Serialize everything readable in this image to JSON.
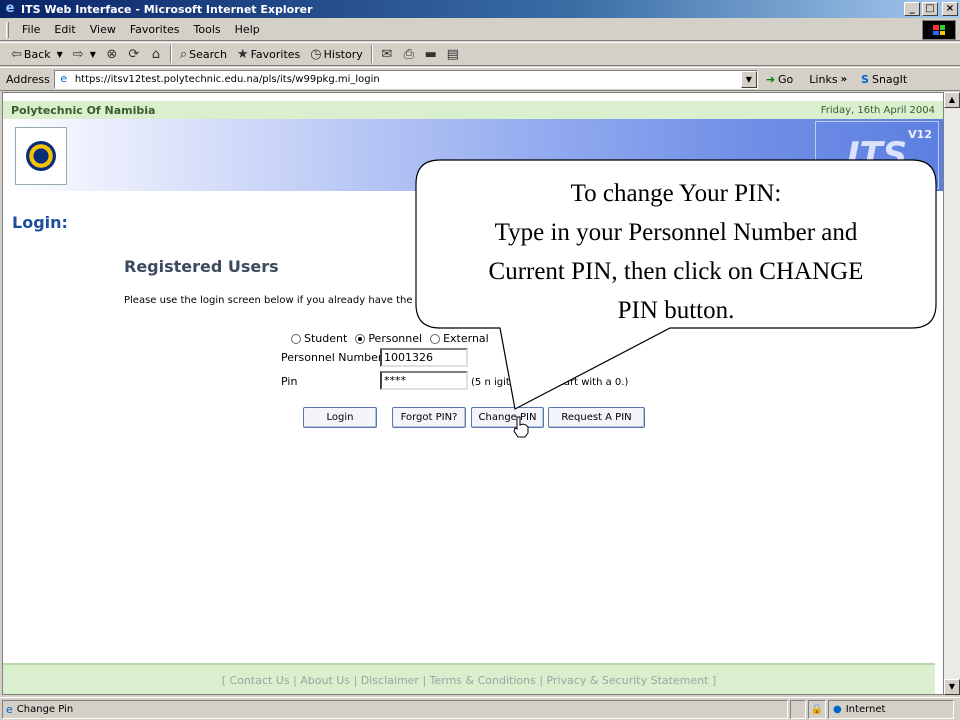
{
  "window": {
    "title": "ITS Web Interface - Microsoft Internet Explorer"
  },
  "menu": [
    "File",
    "Edit",
    "View",
    "Favorites",
    "Tools",
    "Help"
  ],
  "toolbar": {
    "back": "Back",
    "search": "Search",
    "favorites": "Favorites",
    "history": "History"
  },
  "address": {
    "label": "Address",
    "url": "https://itsv12test.polytechnic.edu.na/pls/its/w99pkg.mi_login",
    "go": "Go",
    "links": "Links",
    "snagit": "SnagIt"
  },
  "page": {
    "site_name": "Polytechnic Of Namibia",
    "date": "Friday, 16th April 2004",
    "login_heading": "Login:",
    "registered_heading": "Registered Users",
    "registered_text": "Please use the login screen below if you already have the",
    "radio_options": [
      {
        "label": "Student",
        "selected": false
      },
      {
        "label": "Personnel",
        "selected": true
      },
      {
        "label": "External",
        "selected": false
      }
    ],
    "personnel_label": "Personnel Number",
    "personnel_value": "1001326",
    "pin_label": "Pin",
    "pin_value": "****",
    "pin_hint": "(5 n          igits.Do not start with a 0.)",
    "buttons": {
      "login": "Login",
      "forgot": "Forgot PIN?",
      "change": "Change PIN",
      "request": "Request A PIN"
    },
    "footer_links": "[ Contact Us | About Us | Disclaimer | Terms & Conditions | Privacy & Security Statement ]"
  },
  "callout": {
    "line1": "To change Your PIN:",
    "line2": "Type in your Personnel Number and",
    "line3": "Current PIN, then click on CHANGE",
    "line4": "PIN button."
  },
  "status": {
    "text": "Change Pin",
    "zone": "Internet"
  }
}
